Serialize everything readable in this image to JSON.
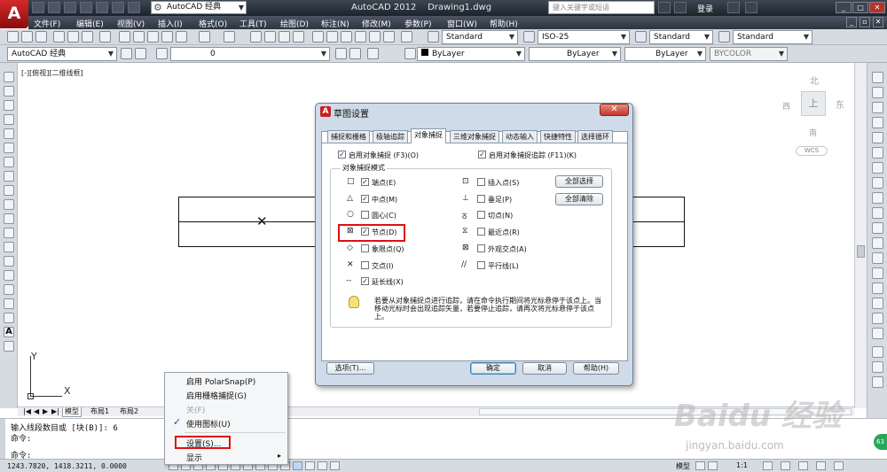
{
  "app": {
    "logo": "A",
    "workspace": "AutoCAD 经典",
    "title": "AutoCAD 2012    Drawing1.dwg",
    "search_placeholder": "键入关键字或短语",
    "login": "登录"
  },
  "menu": [
    "文件(F)",
    "编辑(E)",
    "视图(V)",
    "插入(I)",
    "格式(O)",
    "工具(T)",
    "绘图(D)",
    "标注(N)",
    "修改(M)",
    "参数(P)",
    "窗口(W)",
    "帮助(H)"
  ],
  "toolbar": {
    "text_style": "Standard",
    "dim_style": "ISO-25",
    "table_style": "Standard",
    "mleader_style": "Standard"
  },
  "layers": {
    "workspace": "AutoCAD 经典",
    "layer": "0",
    "color": "ByLayer",
    "linetype": "ByLayer",
    "lineweight": "ByLayer",
    "plotstyle": "BYCOLOR"
  },
  "canvas": {
    "viewport_label": "[-][俯视][二维线框]",
    "compass": {
      "n": "北",
      "e": "东",
      "w": "西",
      "s": "南",
      "top": "上"
    },
    "wcs": "WCS",
    "axis_x": "X",
    "axis_y": "Y"
  },
  "tabs": [
    "模型",
    "布局1",
    "布局2"
  ],
  "command": {
    "line1": "输入线段数目或 [块(B)]: 6",
    "line2": "命令:",
    "line3": "命令:"
  },
  "status": {
    "coords": "1243.7820, 1418.3211, 0.0000",
    "model": "模型",
    "scale": "1:1"
  },
  "context_menu": {
    "items": [
      "启用 PolarSnap(P)",
      "启用栅格捕捉(G)",
      "关(F)",
      "使用图标(U)",
      "设置(S)...",
      "显示"
    ],
    "checked": "✓"
  },
  "dialog": {
    "title": "草图设置",
    "tabs": [
      "捕捉和栅格",
      "极轴追踪",
      "对象捕捉",
      "三维对象捕捉",
      "动态输入",
      "快捷特性",
      "选择循环"
    ],
    "active_tab": "对象捕捉",
    "enable_osnap": "启用对象捕捉 (F3)(O)",
    "enable_tracking": "启用对象捕捉追踪 (F11)(K)",
    "group_title": "对象捕捉模式",
    "left_modes": [
      {
        "sym": "□",
        "label": "端点(E)",
        "checked": true
      },
      {
        "sym": "△",
        "label": "中点(M)",
        "checked": true
      },
      {
        "sym": "○",
        "label": "圆心(C)",
        "checked": false
      },
      {
        "sym": "⊠",
        "label": "节点(D)",
        "checked": true
      },
      {
        "sym": "◇",
        "label": "象限点(Q)",
        "checked": false
      },
      {
        "sym": "✕",
        "label": "交点(I)",
        "checked": false
      },
      {
        "sym": "--",
        "label": "延长线(X)",
        "checked": true
      }
    ],
    "right_modes": [
      {
        "sym": "⊡",
        "label": "插入点(S)",
        "checked": false
      },
      {
        "sym": "⊥",
        "label": "垂足(P)",
        "checked": false
      },
      {
        "sym": "ठ",
        "label": "切点(N)",
        "checked": false
      },
      {
        "sym": "⧖",
        "label": "最近点(R)",
        "checked": false
      },
      {
        "sym": "⊠",
        "label": "外观交点(A)",
        "checked": false
      },
      {
        "sym": "//",
        "label": "平行线(L)",
        "checked": false
      }
    ],
    "select_all": "全部选择",
    "clear_all": "全部清除",
    "info": "若要从对象捕捉点进行追踪，请在命令执行期间将光标悬停于该点上。当移动光标时会出现追踪矢量，若要停止追踪，请再次将光标悬停于该点上。",
    "options_button": "选项(T)...",
    "ok_button": "确定",
    "cancel_button": "取消",
    "help_button": "帮助(H)"
  },
  "watermark": {
    "main": "Baidu 经验",
    "url": "jingyan.baidu.com",
    "badge": "63"
  }
}
